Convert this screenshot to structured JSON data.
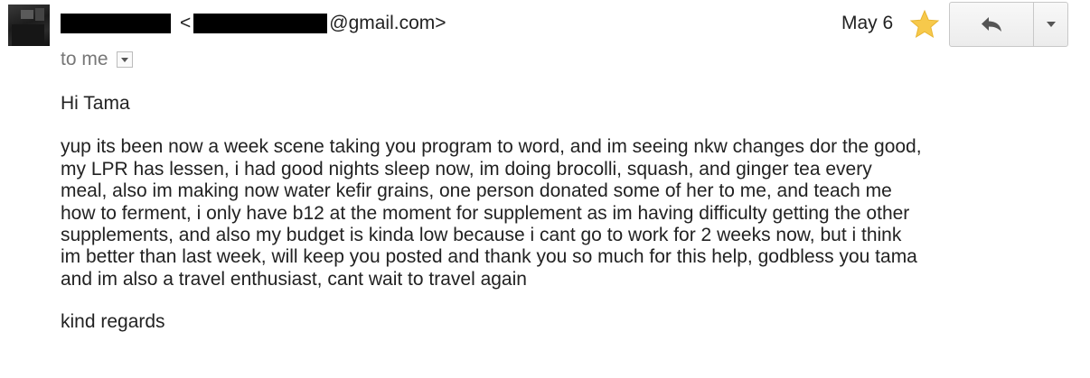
{
  "sender": {
    "email_domain": "@gmail.com>",
    "open_bracket": "<"
  },
  "date": "May 6",
  "recipient_line": "to me",
  "message": {
    "greeting": "Hi Tama",
    "body": "yup its been now a week scene taking you program to word, and im seeing nkw changes dor the good,\nmy LPR has lessen, i had good nights sleep now, im doing brocolli, squash, and ginger tea every\nmeal, also im making now water kefir grains, one person donated some of her to me, and teach me\nhow to ferment, i only have b12 at the moment for supplement as im having difficulty getting the other\nsupplements, and also my budget is kinda low because i cant go to work for 2 weeks now, but i think\nim better than last week, will keep you posted and thank you so much for this help, godbless you tama\nand im also a travel enthusiast, cant wait to travel again",
    "signoff": "kind regards"
  },
  "icons": {
    "star": "star-icon",
    "reply": "reply-arrow-icon",
    "more": "triangle-down-icon"
  },
  "colors": {
    "star": "#f7c94b",
    "text": "#222222",
    "muted": "#777777"
  }
}
